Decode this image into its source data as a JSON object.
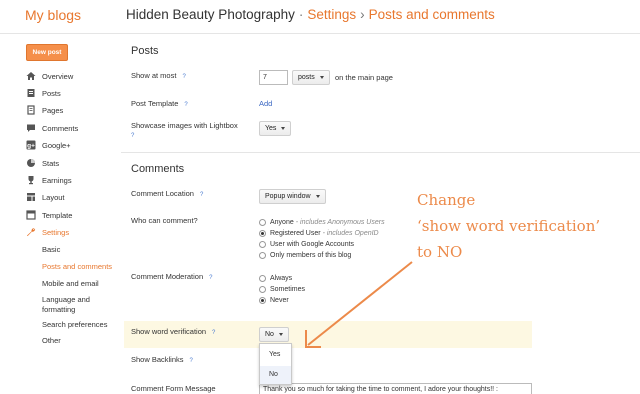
{
  "header": {
    "logo": "My blogs",
    "blog_name": "Hidden Beauty Photography",
    "separator1": "·",
    "section": "Settings",
    "separator2": "›",
    "page": "Posts and comments"
  },
  "sidebar": {
    "new_post": "New post",
    "items": [
      {
        "label": "Overview",
        "icon": "home-icon"
      },
      {
        "label": "Posts",
        "icon": "posts-icon"
      },
      {
        "label": "Pages",
        "icon": "pages-icon"
      },
      {
        "label": "Comments",
        "icon": "comments-icon"
      },
      {
        "label": "Google+",
        "icon": "google-plus-icon"
      },
      {
        "label": "Stats",
        "icon": "stats-icon"
      },
      {
        "label": "Earnings",
        "icon": "earnings-icon"
      },
      {
        "label": "Layout",
        "icon": "layout-icon"
      },
      {
        "label": "Template",
        "icon": "template-icon"
      },
      {
        "label": "Settings",
        "icon": "wrench-icon"
      }
    ],
    "sub_items": [
      "Basic",
      "Posts and comments",
      "Mobile and email",
      "Language and",
      "formatting",
      "Search preferences",
      "Other"
    ]
  },
  "posts": {
    "title": "Posts",
    "show_at_most_label": "Show at most",
    "show_at_most_value": "7",
    "show_at_most_unit": "posts",
    "show_at_most_suffix": "on the main page",
    "post_template_label": "Post Template",
    "post_template_link": "Add",
    "lightbox_label": "Showcase images with Lightbox",
    "lightbox_value": "Yes"
  },
  "comments": {
    "title": "Comments",
    "location_label": "Comment Location",
    "location_value": "Popup window",
    "who_label": "Who can comment?",
    "who_options": [
      {
        "label": "Anyone",
        "note": "- includes Anonymous Users",
        "selected": false
      },
      {
        "label": "Registered User",
        "note": "- includes OpenID",
        "selected": true
      },
      {
        "label": "User with Google Accounts",
        "note": "",
        "selected": false
      },
      {
        "label": "Only members of this blog",
        "note": "",
        "selected": false
      }
    ],
    "moderation_label": "Comment Moderation",
    "moderation_options": [
      {
        "label": "Always",
        "selected": false
      },
      {
        "label": "Sometimes",
        "selected": false
      },
      {
        "label": "Never",
        "selected": true
      }
    ],
    "word_verification_label": "Show word verification",
    "word_verification_value": "No",
    "word_verification_options": [
      "Yes",
      "No"
    ],
    "backlinks_label": "Show Backlinks",
    "form_message_label": "Comment Form Message",
    "form_message_value": "Thank you so much for taking the time to comment, I adore your thoughts!! :"
  },
  "help_glyph": "?",
  "annotation": {
    "line1": "Change",
    "line2": "‘show word verification’",
    "line3": "to NO"
  },
  "colors": {
    "accent": "#e8772e",
    "annotation": "#ec8a4a",
    "link": "#3a67c3"
  }
}
